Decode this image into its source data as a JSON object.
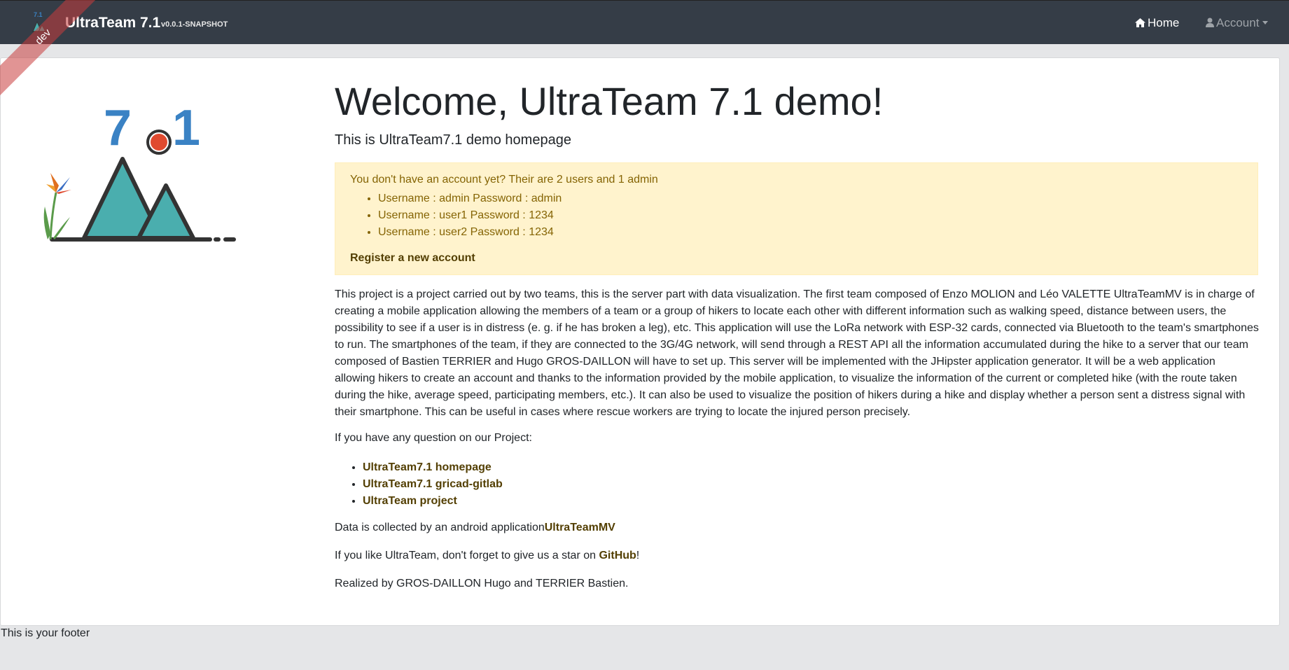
{
  "navbar": {
    "brand_title": "UltraTeam 7.1",
    "brand_version": "v0.0.1-SNAPSHOT",
    "home_label": "Home",
    "account_label": "Account",
    "logo_text": "7.1"
  },
  "ribbon": {
    "label": "dev"
  },
  "logo": {
    "digit_left": "7",
    "digit_right": "1"
  },
  "main": {
    "title": "Welcome, UltraTeam 7.1 demo!",
    "subtitle": "This is UltraTeam7.1 demo homepage",
    "alert": {
      "intro": "You don't have an account yet? Their are 2 users and 1 admin",
      "accounts": [
        "Username : admin Password : admin",
        "Username : user1 Password : 1234",
        "Username : user2 Password : 1234"
      ],
      "register_label": "Register a new account"
    },
    "description": "This project is a project carried out by two teams, this is the server part with data visualization. The first team composed of Enzo MOLION and Léo VALETTE UltraTeamMV is in charge of creating a mobile application allowing the members of a team or a group of hikers to locate each other with different information such as walking speed, distance between users, the possibility to see if a user is in distress (e. g. if he has broken a leg), etc. This application will use the LoRa network with ESP-32 cards, connected via Bluetooth to the team's smartphones to run. The smartphones of the team, if they are connected to the 3G/4G network, will send through a REST API all the information accumulated during the hike to a server that our team composed of Bastien TERRIER and Hugo GROS-DAILLON will have to set up. This server will be implemented with the JHipster application generator. It will be a web application allowing hikers to create an account and thanks to the information provided by the mobile application, to visualize the information of the current or completed hike (with the route taken during the hike, average speed, participating members, etc.). It can also be used to visualize the position of hikers during a hike and display whether a person sent a distress signal with their smartphone. This can be useful in cases where rescue workers are trying to locate the injured person precisely.",
    "question": "If you have any question on our Project:",
    "links": [
      "UltraTeam7.1 homepage",
      "UltraTeam7.1 gricad-gitlab",
      "UltraTeam project"
    ],
    "android_text": "Data is collected by an android application",
    "android_link": "UltraTeamMV",
    "github_prefix": "If you like UltraTeam, don't forget to give us a star on ",
    "github_link": "GitHub",
    "github_suffix": "!",
    "realized": "Realized by GROS-DAILLON Hugo and TERRIER Bastien."
  },
  "footer": {
    "text": "This is your footer"
  },
  "colors": {
    "navbar_bg": "#353d47",
    "alert_bg": "#fff3cd",
    "alert_text": "#856404",
    "link": "#533f03",
    "logo_blue": "#3a82c4",
    "logo_teal": "#4aaeae",
    "logo_red": "#e04a2f",
    "ribbon": "#c83c3c"
  }
}
